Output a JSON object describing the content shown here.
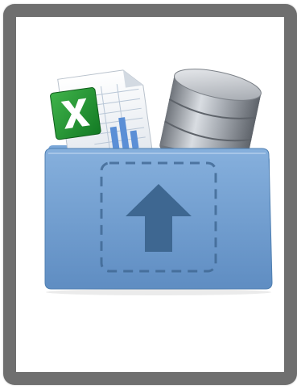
{
  "card": {
    "border_color": "#6f6f6f",
    "background_color": "#ffffff"
  },
  "illustration": {
    "folder_color": "#6f9fd2",
    "folder_dark_color": "#4f7fb1",
    "upload_arrow_color": "#3e6791",
    "excel_green": "#1e8a2e",
    "database_color": "#8b8f96",
    "icons": [
      "excel-file-icon",
      "database-icon",
      "upload-folder-icon",
      "upload-arrow-icon"
    ]
  }
}
